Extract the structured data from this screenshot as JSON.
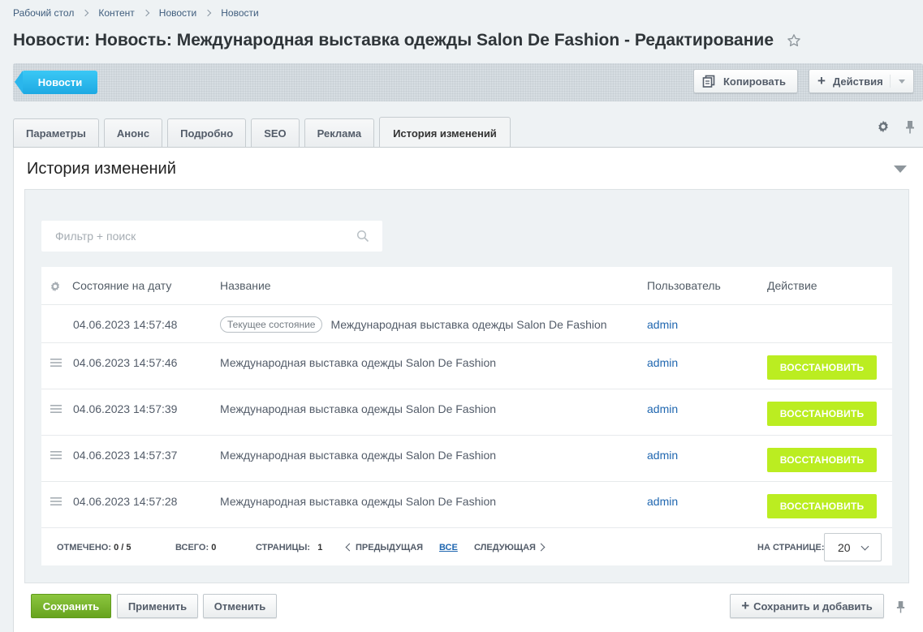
{
  "breadcrumb": [
    "Рабочий стол",
    "Контент",
    "Новости",
    "Новости"
  ],
  "page_title": "Новости: Новость: Международная выставка одежды Salon De Fashion - Редактирование",
  "toolbar": {
    "back_label": "Новости",
    "copy_label": "Копировать",
    "actions_label": "Действия"
  },
  "tabs": [
    "Параметры",
    "Анонс",
    "Подробно",
    "SEO",
    "Реклама",
    "История изменений"
  ],
  "active_tab": "История изменений",
  "section": {
    "title": "История изменений"
  },
  "search": {
    "placeholder": "Фильтр + поиск"
  },
  "grid": {
    "columns": {
      "date": "Состояние на дату",
      "name": "Название",
      "user": "Пользователь",
      "action": "Действие"
    },
    "current_badge": "Текущее состояние",
    "restore_label": "ВОССТАНОВИТЬ",
    "rows": [
      {
        "date": "04.06.2023 14:57:48",
        "name": "Международная выставка одежды Salon De Fashion",
        "user": "admin"
      },
      {
        "date": "04.06.2023 14:57:46",
        "name": "Международная выставка одежды Salon De Fashion",
        "user": "admin"
      },
      {
        "date": "04.06.2023 14:57:39",
        "name": "Международная выставка одежды Salon De Fashion",
        "user": "admin"
      },
      {
        "date": "04.06.2023 14:57:37",
        "name": "Международная выставка одежды Salon De Fashion",
        "user": "admin"
      },
      {
        "date": "04.06.2023 14:57:28",
        "name": "Международная выставка одежды Salon De Fashion",
        "user": "admin"
      }
    ]
  },
  "footer": {
    "checked_label": "ОТМЕЧЕНО:",
    "checked_value": "0 / 5",
    "total_label": "ВСЕГО:",
    "total_value": "0",
    "pages_label": "СТРАНИЦЫ:",
    "pages_value": "1",
    "prev_label": "ПРЕДЫДУЩАЯ",
    "all_label": "ВСЕ",
    "next_label": "СЛЕДУЮЩАЯ",
    "per_page_label": "НА СТРАНИЦЕ:",
    "per_page_value": "20"
  },
  "buttons": {
    "save": "Сохранить",
    "apply": "Применить",
    "cancel": "Отменить",
    "save_add": "Сохранить и добавить"
  },
  "colors": {
    "accent_blue": "#2ab6ec",
    "restore_green": "#bbed21",
    "save_green": "#7ab52e",
    "link": "#2067b0"
  }
}
